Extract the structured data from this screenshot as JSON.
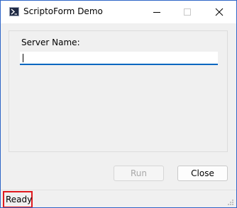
{
  "window": {
    "title": "ScriptoForm Demo",
    "accent_color": "#2f66c7",
    "icon": "powershell-icon",
    "controls": [
      "minimize-icon",
      "maximize-icon",
      "close-icon"
    ]
  },
  "form": {
    "server_label": "Server Name:",
    "server_value": "",
    "focus_color": "#0067c0"
  },
  "buttons": {
    "run_label": "Run",
    "run_enabled": false,
    "close_label": "Close"
  },
  "status": {
    "text": "Ready",
    "highlight_color": "#e0191e"
  }
}
